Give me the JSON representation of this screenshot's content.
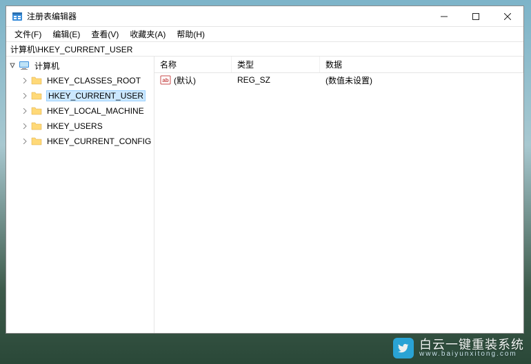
{
  "titlebar": {
    "title": "注册表编辑器"
  },
  "menubar": {
    "items": [
      {
        "label": "文件(F)"
      },
      {
        "label": "编辑(E)"
      },
      {
        "label": "查看(V)"
      },
      {
        "label": "收藏夹(A)"
      },
      {
        "label": "帮助(H)"
      }
    ]
  },
  "addressbar": {
    "path": "计算机\\HKEY_CURRENT_USER"
  },
  "tree": {
    "root": {
      "label": "计算机",
      "expanded": true,
      "children": [
        {
          "label": "HKEY_CLASSES_ROOT",
          "selected": false
        },
        {
          "label": "HKEY_CURRENT_USER",
          "selected": true
        },
        {
          "label": "HKEY_LOCAL_MACHINE",
          "selected": false
        },
        {
          "label": "HKEY_USERS",
          "selected": false
        },
        {
          "label": "HKEY_CURRENT_CONFIG",
          "selected": false
        }
      ]
    }
  },
  "list": {
    "columns": {
      "name": "名称",
      "type": "类型",
      "data": "数据"
    },
    "rows": [
      {
        "name": "(默认)",
        "type": "REG_SZ",
        "data": "(数值未设置)"
      }
    ]
  },
  "watermark": {
    "main": "白云一键重装系统",
    "sub": "www.baiyunxitong.com"
  }
}
